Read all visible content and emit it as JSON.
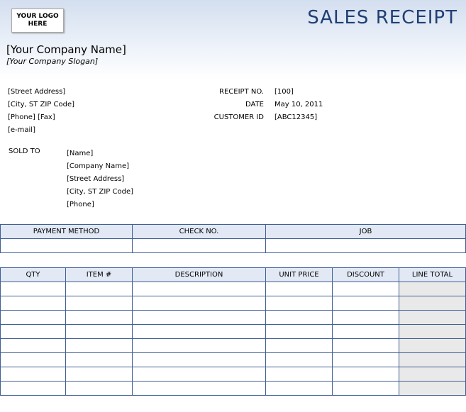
{
  "header": {
    "logo_line1": "YOUR LOGO",
    "logo_line2": "HERE",
    "title": "SALES RECEIPT",
    "company_name": "[Your Company Name]",
    "company_slogan": "[Your Company Slogan]"
  },
  "company_address": {
    "street": "[Street Address]",
    "city": "[City, ST  ZIP Code]",
    "phone_fax": "[Phone] [Fax]",
    "email": "[e-mail]"
  },
  "receipt_info": {
    "receipt_no_label": "RECEIPT  NO.",
    "receipt_no_value": "[100]",
    "date_label": "DATE",
    "date_value": "May 10, 2011",
    "customer_id_label": "CUSTOMER ID",
    "customer_id_value": "[ABC12345]"
  },
  "sold_to": {
    "label": "SOLD TO",
    "name": "[Name]",
    "company": "[Company Name]",
    "street": "[Street Address]",
    "city": "[City, ST  ZIP Code]",
    "phone": "[Phone]"
  },
  "payment_table": {
    "headers": [
      "PAYMENT METHOD",
      "CHECK NO.",
      "JOB"
    ]
  },
  "items_table": {
    "headers": [
      "QTY",
      "ITEM #",
      "DESCRIPTION",
      "UNIT PRICE",
      "DISCOUNT",
      "LINE TOTAL"
    ],
    "row_count": 8
  }
}
